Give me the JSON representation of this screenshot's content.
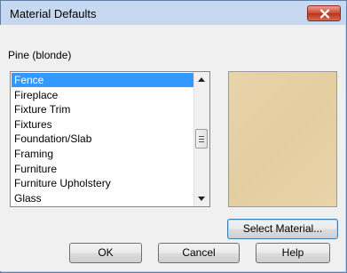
{
  "window": {
    "title": "Material Defaults"
  },
  "material": {
    "name": "Pine (blonde)",
    "swatch_color": "#e8d4a9"
  },
  "list": {
    "items": [
      {
        "label": "Fence",
        "selected": true
      },
      {
        "label": "Fireplace",
        "selected": false
      },
      {
        "label": "Fixture Trim",
        "selected": false
      },
      {
        "label": "Fixtures",
        "selected": false
      },
      {
        "label": "Foundation/Slab",
        "selected": false
      },
      {
        "label": "Framing",
        "selected": false
      },
      {
        "label": "Furniture",
        "selected": false
      },
      {
        "label": "Furniture Upholstery",
        "selected": false
      },
      {
        "label": "Glass",
        "selected": false
      }
    ]
  },
  "buttons": {
    "select_material": "Select Material...",
    "ok": "OK",
    "cancel": "Cancel",
    "help": "Help"
  },
  "colors": {
    "selection": "#3399ff",
    "close_button": "#c94a31"
  }
}
